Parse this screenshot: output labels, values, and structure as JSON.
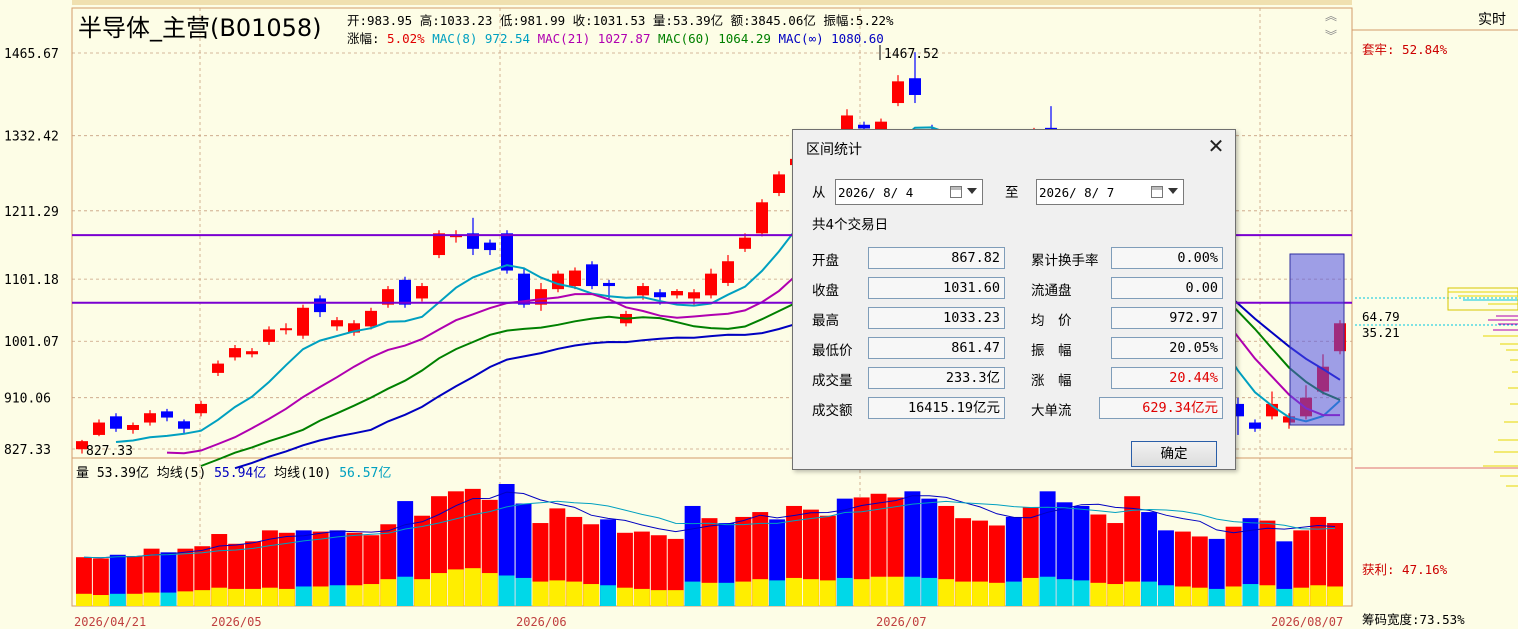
{
  "header": {
    "title": "半导体_主营(B01058)",
    "line1": [
      {
        "label": "开:",
        "value": "983.95",
        "color": "#000"
      },
      {
        "label": " 高:",
        "value": "1033.23",
        "color": "#000"
      },
      {
        "label": " 低:",
        "value": "981.99",
        "color": "#000"
      },
      {
        "label": " 收:",
        "value": "1031.53",
        "color": "#000"
      },
      {
        "label": " 量:",
        "value": "53.39亿",
        "color": "#000"
      },
      {
        "label": " 额:",
        "value": "3845.06亿",
        "color": "#000"
      },
      {
        "label": " 振幅:",
        "value": "5.22%",
        "color": "#000"
      }
    ],
    "line2": [
      {
        "label": "涨幅:",
        "value": " 5.02%",
        "color": "#e00000",
        "labelColor": "#000"
      },
      {
        "label": " MAC(8)",
        "value": " 972.54",
        "color": "#00a0c0",
        "labelColor": "#00a0c0"
      },
      {
        "label": " MAC(21)",
        "value": " 1027.87",
        "color": "#b000b0",
        "labelColor": "#b000b0"
      },
      {
        "label": " MAC(60)",
        "value": " 1064.29",
        "color": "#008000",
        "labelColor": "#008000"
      },
      {
        "label": " MAC(∞)",
        "value": " 1080.60",
        "color": "#0000c0",
        "labelColor": "#0000c0"
      }
    ]
  },
  "right_tab": "实时",
  "right_labels": {
    "taolao": "套牢: 52.84%",
    "huoli": "获利: 47.16%",
    "chouma": "筹码宽度:73.53%",
    "p1": "64.79",
    "p2": "35.21"
  },
  "volume_header": {
    "vol_label": "量 53.39亿",
    "ma5_label": " 均线(5)",
    "ma5_value": " 55.94亿",
    "ma10_label": " 均线(10)",
    "ma10_value": " 56.57亿"
  },
  "dialog": {
    "title": "区间统计",
    "from_label": "从",
    "to_label": "至",
    "from_date": "2026/ 8/ 4",
    "to_date": "2026/ 8/ 7",
    "trading_days": "共4个交易日",
    "ok_button": "确定",
    "left_fields": [
      {
        "label": "开盘",
        "value": "867.82"
      },
      {
        "label": "收盘",
        "value": "1031.60"
      },
      {
        "label": "最高",
        "value": "1033.23"
      },
      {
        "label": "最低价",
        "value": "861.47"
      },
      {
        "label": "成交量",
        "value": "233.3亿"
      },
      {
        "label": "成交额",
        "value": "16415.19亿元"
      }
    ],
    "right_fields": [
      {
        "label": "累计换手率",
        "value": "0.00%",
        "color": "#000"
      },
      {
        "label": "流通盘",
        "value": "0.00",
        "color": "#000"
      },
      {
        "label": "均　价",
        "value": "972.97",
        "color": "#000"
      },
      {
        "label": "振　幅",
        "value": "20.05%",
        "color": "#000"
      },
      {
        "label": "涨　幅",
        "value": "20.44%",
        "color": "#e00000"
      },
      {
        "label": "大单流",
        "value": "629.34亿元",
        "color": "#e00000"
      }
    ]
  },
  "chart_data": {
    "type": "candlestick",
    "y_ticks": [
      827.33,
      910.06,
      1001.07,
      1101.18,
      1211.29,
      1332.42,
      1465.67
    ],
    "x_ticks": [
      "2026/04/21",
      "2026/05",
      "2026/06",
      "2026/07",
      "2026/08/07"
    ],
    "annotations": {
      "high_label": "1467.52",
      "low_label": "827.33"
    },
    "horizontal_lines": [
      1172,
      1063
    ],
    "colors": {
      "up": "#ff0000",
      "down": "#0000ff",
      "ma8": "#00a0c0",
      "ma21": "#b000b0",
      "ma60": "#008000",
      "mainf": "#0000c0",
      "hline": "#7a00d0",
      "vol_yellow": "#ffee00",
      "vol_cyan": "#00d8e8"
    },
    "candles": [
      [
        827,
        840,
        820,
        842
      ],
      [
        850,
        870,
        848,
        875
      ],
      [
        880,
        860,
        855,
        885
      ],
      [
        858,
        866,
        852,
        870
      ],
      [
        870,
        885,
        865,
        890
      ],
      [
        888,
        878,
        872,
        892
      ],
      [
        872,
        860,
        852,
        875
      ],
      [
        885,
        900,
        880,
        905
      ],
      [
        950,
        965,
        945,
        970
      ],
      [
        975,
        990,
        970,
        995
      ],
      [
        980,
        985,
        975,
        990
      ],
      [
        1000,
        1020,
        995,
        1025
      ],
      [
        1020,
        1022,
        1012,
        1030
      ],
      [
        1010,
        1055,
        1005,
        1060
      ],
      [
        1070,
        1048,
        1040,
        1075
      ],
      [
        1025,
        1035,
        1018,
        1040
      ],
      [
        1015,
        1030,
        1010,
        1035
      ],
      [
        1025,
        1050,
        1020,
        1055
      ],
      [
        1060,
        1085,
        1055,
        1090
      ],
      [
        1100,
        1060,
        1055,
        1105
      ],
      [
        1070,
        1090,
        1065,
        1095
      ],
      [
        1140,
        1175,
        1135,
        1180
      ],
      [
        1170,
        1172,
        1160,
        1180
      ],
      [
        1175,
        1150,
        1140,
        1200
      ],
      [
        1160,
        1148,
        1140,
        1165
      ],
      [
        1175,
        1115,
        1110,
        1180
      ],
      [
        1110,
        1060,
        1055,
        1120
      ],
      [
        1060,
        1085,
        1050,
        1095
      ],
      [
        1085,
        1110,
        1080,
        1115
      ],
      [
        1090,
        1115,
        1085,
        1120
      ],
      [
        1125,
        1090,
        1085,
        1130
      ],
      [
        1095,
        1090,
        1070,
        1100
      ],
      [
        1030,
        1045,
        1025,
        1050
      ],
      [
        1075,
        1090,
        1068,
        1095
      ],
      [
        1080,
        1072,
        1060,
        1085
      ],
      [
        1075,
        1082,
        1070,
        1085
      ],
      [
        1070,
        1080,
        1060,
        1085
      ],
      [
        1075,
        1110,
        1070,
        1118
      ],
      [
        1095,
        1130,
        1090,
        1140
      ],
      [
        1150,
        1168,
        1145,
        1175
      ],
      [
        1175,
        1225,
        1170,
        1230
      ],
      [
        1240,
        1270,
        1235,
        1275
      ],
      [
        1285,
        1295,
        1265,
        1300
      ],
      [
        1275,
        1255,
        1245,
        1280
      ],
      [
        1260,
        1298,
        1255,
        1305
      ],
      [
        1340,
        1365,
        1335,
        1375
      ],
      [
        1350,
        1344,
        1320,
        1355
      ],
      [
        1340,
        1355,
        1330,
        1360
      ],
      [
        1385,
        1420,
        1380,
        1430
      ],
      [
        1425,
        1398,
        1385,
        1467
      ],
      [
        1312,
        1300,
        1290,
        1350
      ],
      [
        1280,
        1305,
        1275,
        1315
      ],
      [
        1290,
        1300,
        1280,
        1305
      ],
      [
        1270,
        1280,
        1260,
        1285
      ],
      [
        1260,
        1270,
        1250,
        1275
      ],
      [
        1250,
        1260,
        1240,
        1262
      ],
      [
        1300,
        1340,
        1295,
        1345
      ],
      [
        1345,
        1310,
        1300,
        1380
      ],
      [
        1240,
        1230,
        1220,
        1245
      ],
      [
        1220,
        1210,
        1200,
        1225
      ],
      [
        1200,
        1190,
        1180,
        1205
      ],
      [
        1180,
        1170,
        1160,
        1185
      ],
      [
        1140,
        1130,
        1120,
        1145
      ],
      [
        1080,
        1070,
        1060,
        1085
      ],
      [
        1040,
        1030,
        1020,
        1045
      ],
      [
        1000,
        990,
        980,
        1005
      ],
      [
        960,
        950,
        940,
        965
      ],
      [
        920,
        910,
        880,
        925
      ],
      [
        900,
        880,
        850,
        910
      ],
      [
        870,
        860,
        855,
        875
      ],
      [
        880,
        900,
        875,
        920
      ],
      [
        870,
        880,
        860,
        885
      ],
      [
        880,
        910,
        875,
        930
      ],
      [
        920,
        960,
        915,
        980
      ],
      [
        985,
        1030,
        980,
        1035
      ]
    ],
    "volumes": [
      [
        0.4,
        0.1,
        1
      ],
      [
        0.39,
        0.09,
        1
      ],
      [
        0.42,
        0.1,
        0
      ],
      [
        0.41,
        0.1,
        1
      ],
      [
        0.47,
        0.11,
        1
      ],
      [
        0.44,
        0.11,
        0
      ],
      [
        0.47,
        0.12,
        1
      ],
      [
        0.49,
        0.13,
        1
      ],
      [
        0.59,
        0.15,
        1
      ],
      [
        0.51,
        0.14,
        1
      ],
      [
        0.53,
        0.14,
        1
      ],
      [
        0.62,
        0.15,
        1
      ],
      [
        0.6,
        0.14,
        1
      ],
      [
        0.62,
        0.16,
        0
      ],
      [
        0.61,
        0.16,
        1
      ],
      [
        0.62,
        0.17,
        0
      ],
      [
        0.6,
        0.17,
        1
      ],
      [
        0.58,
        0.18,
        1
      ],
      [
        0.67,
        0.22,
        1
      ],
      [
        0.86,
        0.24,
        0
      ],
      [
        0.74,
        0.22,
        1
      ],
      [
        0.9,
        0.27,
        1
      ],
      [
        0.94,
        0.3,
        1
      ],
      [
        0.96,
        0.31,
        1
      ],
      [
        0.87,
        0.27,
        1
      ],
      [
        1.0,
        0.25,
        0
      ],
      [
        0.84,
        0.23,
        0
      ],
      [
        0.68,
        0.2,
        1
      ],
      [
        0.8,
        0.21,
        1
      ],
      [
        0.73,
        0.2,
        1
      ],
      [
        0.67,
        0.18,
        1
      ],
      [
        0.71,
        0.17,
        0
      ],
      [
        0.6,
        0.15,
        1
      ],
      [
        0.61,
        0.14,
        1
      ],
      [
        0.58,
        0.13,
        1
      ],
      [
        0.55,
        0.13,
        1
      ],
      [
        0.82,
        0.2,
        0
      ],
      [
        0.72,
        0.19,
        1
      ],
      [
        0.68,
        0.19,
        0
      ],
      [
        0.73,
        0.2,
        1
      ],
      [
        0.77,
        0.22,
        1
      ],
      [
        0.71,
        0.21,
        0
      ],
      [
        0.82,
        0.23,
        1
      ],
      [
        0.79,
        0.22,
        1
      ],
      [
        0.74,
        0.21,
        1
      ],
      [
        0.88,
        0.23,
        0
      ],
      [
        0.89,
        0.22,
        1
      ],
      [
        0.92,
        0.24,
        1
      ],
      [
        0.89,
        0.24,
        1
      ],
      [
        0.94,
        0.24,
        0
      ],
      [
        0.88,
        0.23,
        0
      ],
      [
        0.82,
        0.22,
        1
      ],
      [
        0.72,
        0.2,
        1
      ],
      [
        0.7,
        0.2,
        1
      ],
      [
        0.66,
        0.19,
        1
      ],
      [
        0.73,
        0.2,
        0
      ],
      [
        0.81,
        0.23,
        1
      ],
      [
        0.94,
        0.24,
        0
      ],
      [
        0.85,
        0.22,
        0
      ],
      [
        0.82,
        0.21,
        0
      ],
      [
        0.75,
        0.19,
        1
      ],
      [
        0.68,
        0.18,
        1
      ],
      [
        0.9,
        0.2,
        1
      ],
      [
        0.77,
        0.2,
        0
      ],
      [
        0.62,
        0.17,
        0
      ],
      [
        0.61,
        0.16,
        1
      ],
      [
        0.57,
        0.15,
        1
      ],
      [
        0.55,
        0.14,
        0
      ],
      [
        0.65,
        0.16,
        1
      ],
      [
        0.72,
        0.18,
        0
      ],
      [
        0.7,
        0.17,
        1
      ],
      [
        0.53,
        0.14,
        0
      ],
      [
        0.62,
        0.15,
        1
      ],
      [
        0.73,
        0.17,
        1
      ],
      [
        0.68,
        0.16,
        1
      ]
    ]
  }
}
